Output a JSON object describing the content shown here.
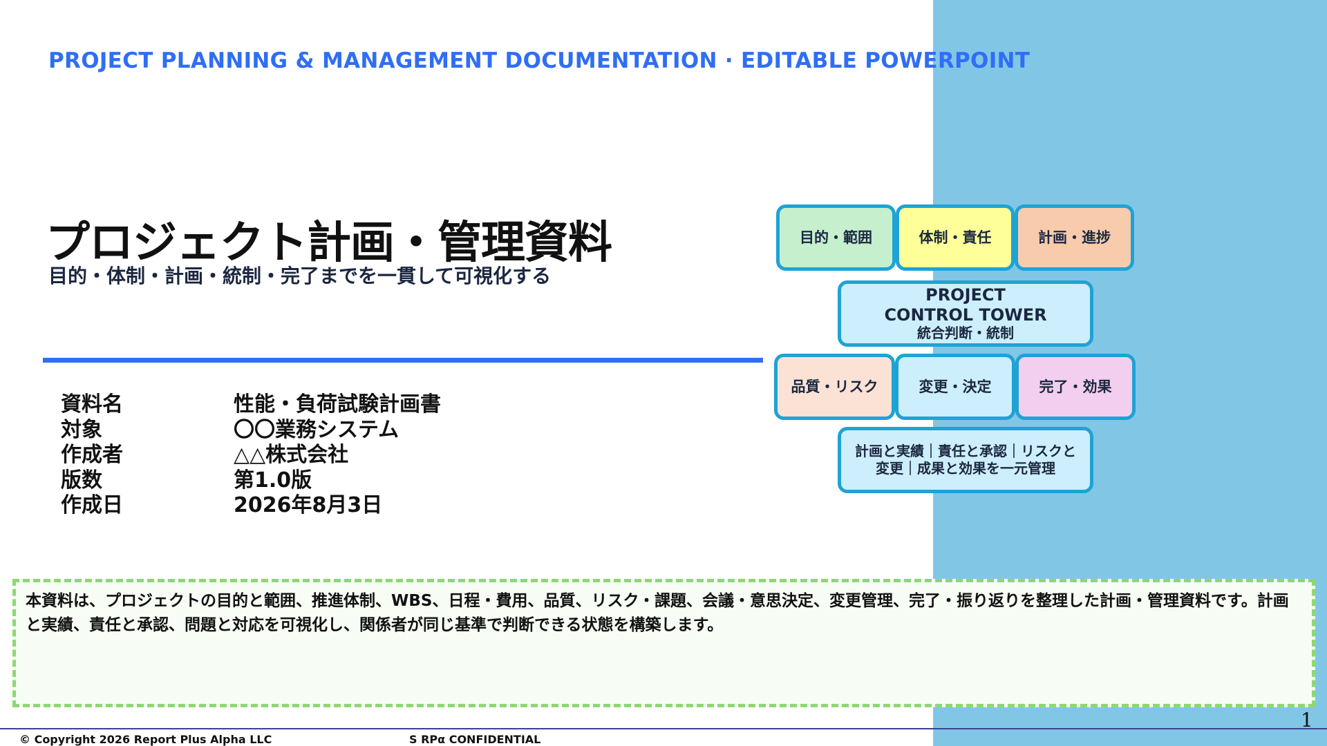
{
  "header": {
    "tagline": "PROJECT PLANNING & MANAGEMENT DOCUMENTATION · EDITABLE POWERPOINT"
  },
  "title": "プロジェクト計画・管理資料",
  "subtitle": "目的・体制・計画・統制・完了までを一貫して可視化する",
  "meta": [
    {
      "label": "資料名",
      "value": "性能・負荷試験計画書"
    },
    {
      "label": "対象",
      "value": "〇〇業務システム"
    },
    {
      "label": "作成者",
      "value": "△△株式会社"
    },
    {
      "label": "版数",
      "value": "第1.0版"
    },
    {
      "label": "作成日",
      "value": "2026年8月3日"
    }
  ],
  "diagram": {
    "top_boxes": [
      "目的・範囲",
      "体制・責任",
      "計画・進捗"
    ],
    "tower": {
      "title_line1": "PROJECT",
      "title_line2": "CONTROL TOWER",
      "subtitle": "統合判断・統制"
    },
    "bottom_boxes": [
      "品質・リスク",
      "変更・決定",
      "完了・効果"
    ],
    "summary_line1": "計画と実績｜責任と承認｜リスクと",
    "summary_line2": "変更｜成果と効果を一元管理"
  },
  "note": "本資料は、プロジェクトの目的と範囲、推進体制、WBS、日程・費用、品質、リスク・課題、会議・意思決定、変更管理、完了・振り返りを整理した計画・管理資料です。計画と実績、責任と承認、問題と対応を可視化し、関係者が同じ基準で判断できる状態を構築します。",
  "footer": {
    "copyright": "© Copyright 2026 Report Plus Alpha LLC",
    "confidential": "S RPα CONFIDENTIAL",
    "page": "1"
  },
  "colors": {
    "accent_blue": "#2f6ef5",
    "panel_blue": "#82c6e6",
    "box_border": "#1ea3d5",
    "box_green": "#c6efce",
    "box_yellow": "#ffff99",
    "box_orange": "#f8cbad",
    "box_light_blue": "#cdeefc",
    "box_peach": "#fbe2d5",
    "box_lavender": "#f2cfee",
    "note_border": "#8ed873"
  }
}
